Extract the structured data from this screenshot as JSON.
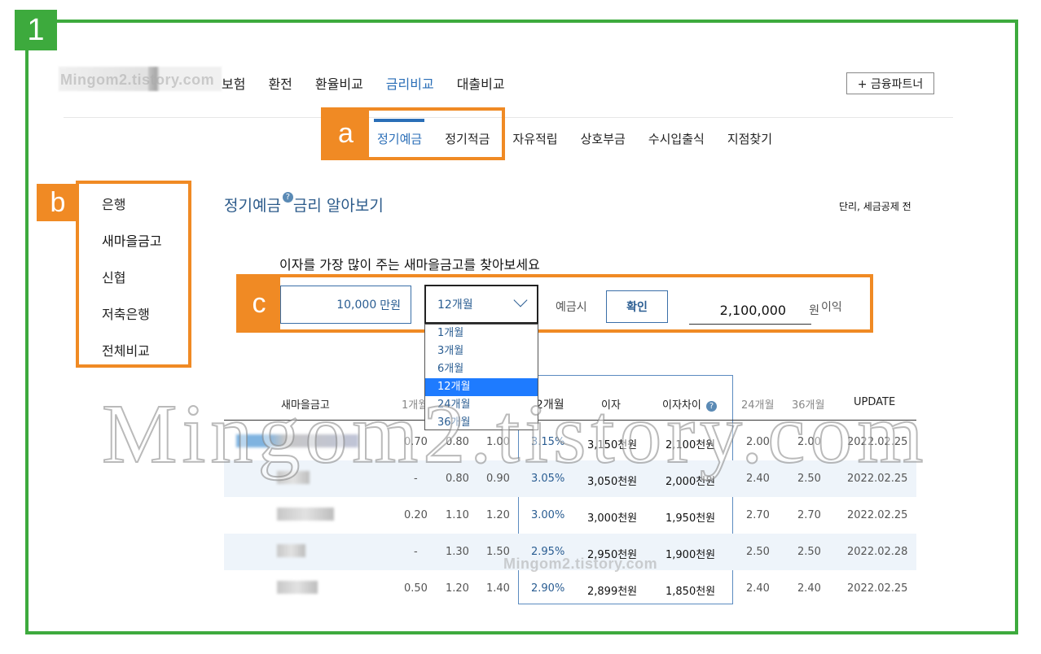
{
  "annotations": {
    "step_number": "1",
    "label_a": "a",
    "label_b": "b",
    "label_c": "c",
    "colors": {
      "frame": "#3daa3d",
      "highlight": "#f08a24",
      "accent": "#2a6eb7"
    }
  },
  "watermark": {
    "small": "Mingom2.tistory.com",
    "big": "Mingom2.tistory.com"
  },
  "top_nav": {
    "items": [
      "보험",
      "환전",
      "환율비교",
      "금리비교",
      "대출비교"
    ],
    "active": "금리비교",
    "partner_button": "+ 금융파트너"
  },
  "sub_nav": {
    "items": [
      "정기예금",
      "정기적금",
      "자유적립",
      "상호부금",
      "수시입출식",
      "지점찾기"
    ],
    "active": "정기예금"
  },
  "sidebar": {
    "items": [
      "은행",
      "새마을금고",
      "신협",
      "저축은행",
      "전체비교"
    ],
    "active": "새마을금고"
  },
  "section": {
    "title_part1": "정기예금",
    "title_part2": "금리 알아보기",
    "help_icon": "?",
    "tax_note": "단리, 세금공제 전"
  },
  "calculator": {
    "heading": "이자를 가장 많이 주는 새마을금고를 찾아보세요",
    "amount_value": "10,000",
    "amount_unit": "만원",
    "period_selected": "12개월",
    "deposit_label": "예금시",
    "confirm_button": "확인",
    "result_value": "2,100,000",
    "result_unit": "원",
    "profit_label": "이익",
    "period_options": [
      "1개월",
      "3개월",
      "6개월",
      "12개월",
      "24개월",
      "36개월"
    ]
  },
  "table": {
    "headers": [
      "새마을금고",
      "1개월",
      "12개월",
      "이자",
      "이자차이",
      "24개월",
      "36개월",
      "UPDATE"
    ],
    "rows": [
      [
        "0.70",
        "0.80",
        "1.00",
        "3.15%",
        "3,150천원",
        "2,100천원",
        "2.00",
        "2.00",
        "2022.02.25"
      ],
      [
        "-",
        "0.80",
        "0.90",
        "3.05%",
        "3,050천원",
        "2,000천원",
        "2.40",
        "2.50",
        "2022.02.25"
      ],
      [
        "0.20",
        "1.10",
        "1.20",
        "3.00%",
        "3,000천원",
        "1,950천원",
        "2.70",
        "2.70",
        "2022.02.25"
      ],
      [
        "-",
        "1.30",
        "1.50",
        "2.95%",
        "2,950천원",
        "1,900천원",
        "2.50",
        "2.50",
        "2022.02.28"
      ],
      [
        "0.50",
        "1.20",
        "1.40",
        "2.90%",
        "2,899천원",
        "1,850천원",
        "2.40",
        "2.40",
        "2022.02.25"
      ]
    ]
  }
}
